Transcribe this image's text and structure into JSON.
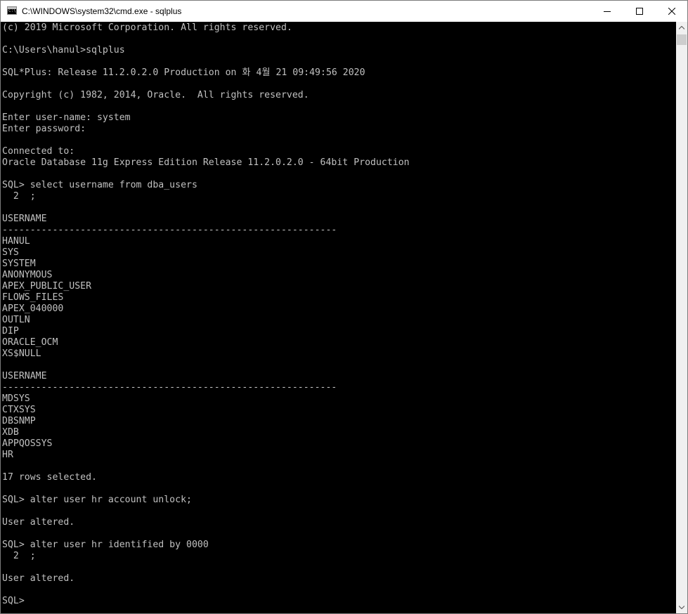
{
  "window": {
    "title": "C:\\WINDOWS\\system32\\cmd.exe - sqlplus",
    "buttons": {
      "minimize": "minimize",
      "maximize": "maximize",
      "close": "close"
    }
  },
  "colors": {
    "console_background": "#000000",
    "console_text": "#c0c0c0",
    "titlebar": "#ffffff",
    "scrollbar_track": "#f0f0f0",
    "scrollbar_thumb": "#cdcdcd"
  },
  "icons": {
    "app": "cmd-console-icon",
    "minimize": "minimize-icon",
    "maximize": "maximize-icon",
    "close": "close-icon",
    "scroll_up": "scroll-up-arrow-icon",
    "scroll_down": "scroll-down-arrow-icon"
  },
  "console": {
    "lines": [
      "(c) 2019 Microsoft Corporation. All rights reserved.",
      "",
      "C:\\Users\\hanul>sqlplus",
      "",
      "SQL*Plus: Release 11.2.0.2.0 Production on 화 4월 21 09:49:56 2020",
      "",
      "Copyright (c) 1982, 2014, Oracle.  All rights reserved.",
      "",
      "Enter user-name: system",
      "Enter password:",
      "",
      "Connected to:",
      "Oracle Database 11g Express Edition Release 11.2.0.2.0 - 64bit Production",
      "",
      "SQL> select username from dba_users",
      "  2  ;",
      "",
      "USERNAME",
      "------------------------------------------------------------",
      "HANUL",
      "SYS",
      "SYSTEM",
      "ANONYMOUS",
      "APEX_PUBLIC_USER",
      "FLOWS_FILES",
      "APEX_040000",
      "OUTLN",
      "DIP",
      "ORACLE_OCM",
      "XS$NULL",
      "",
      "USERNAME",
      "------------------------------------------------------------",
      "MDSYS",
      "CTXSYS",
      "DBSNMP",
      "XDB",
      "APPQOSSYS",
      "HR",
      "",
      "17 rows selected.",
      "",
      "SQL> alter user hr account unlock;",
      "",
      "User altered.",
      "",
      "SQL> alter user hr identified by 0000",
      "  2  ;",
      "",
      "User altered.",
      "",
      "SQL>"
    ]
  }
}
